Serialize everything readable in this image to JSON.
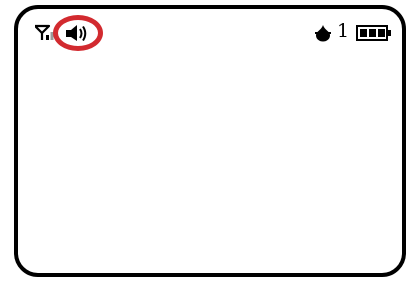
{
  "status_bar": {
    "icons": {
      "signal": "signal-antenna-icon",
      "sound": "speaker-sound-icon",
      "brightness": "brightness-drop-icon",
      "battery": "battery-full-icon"
    },
    "count_value": "1",
    "battery_level": 1.0,
    "highlighted_icon": "sound"
  },
  "colors": {
    "frame": "#000000",
    "background": "#ffffff",
    "highlight": "#d22a2f"
  }
}
